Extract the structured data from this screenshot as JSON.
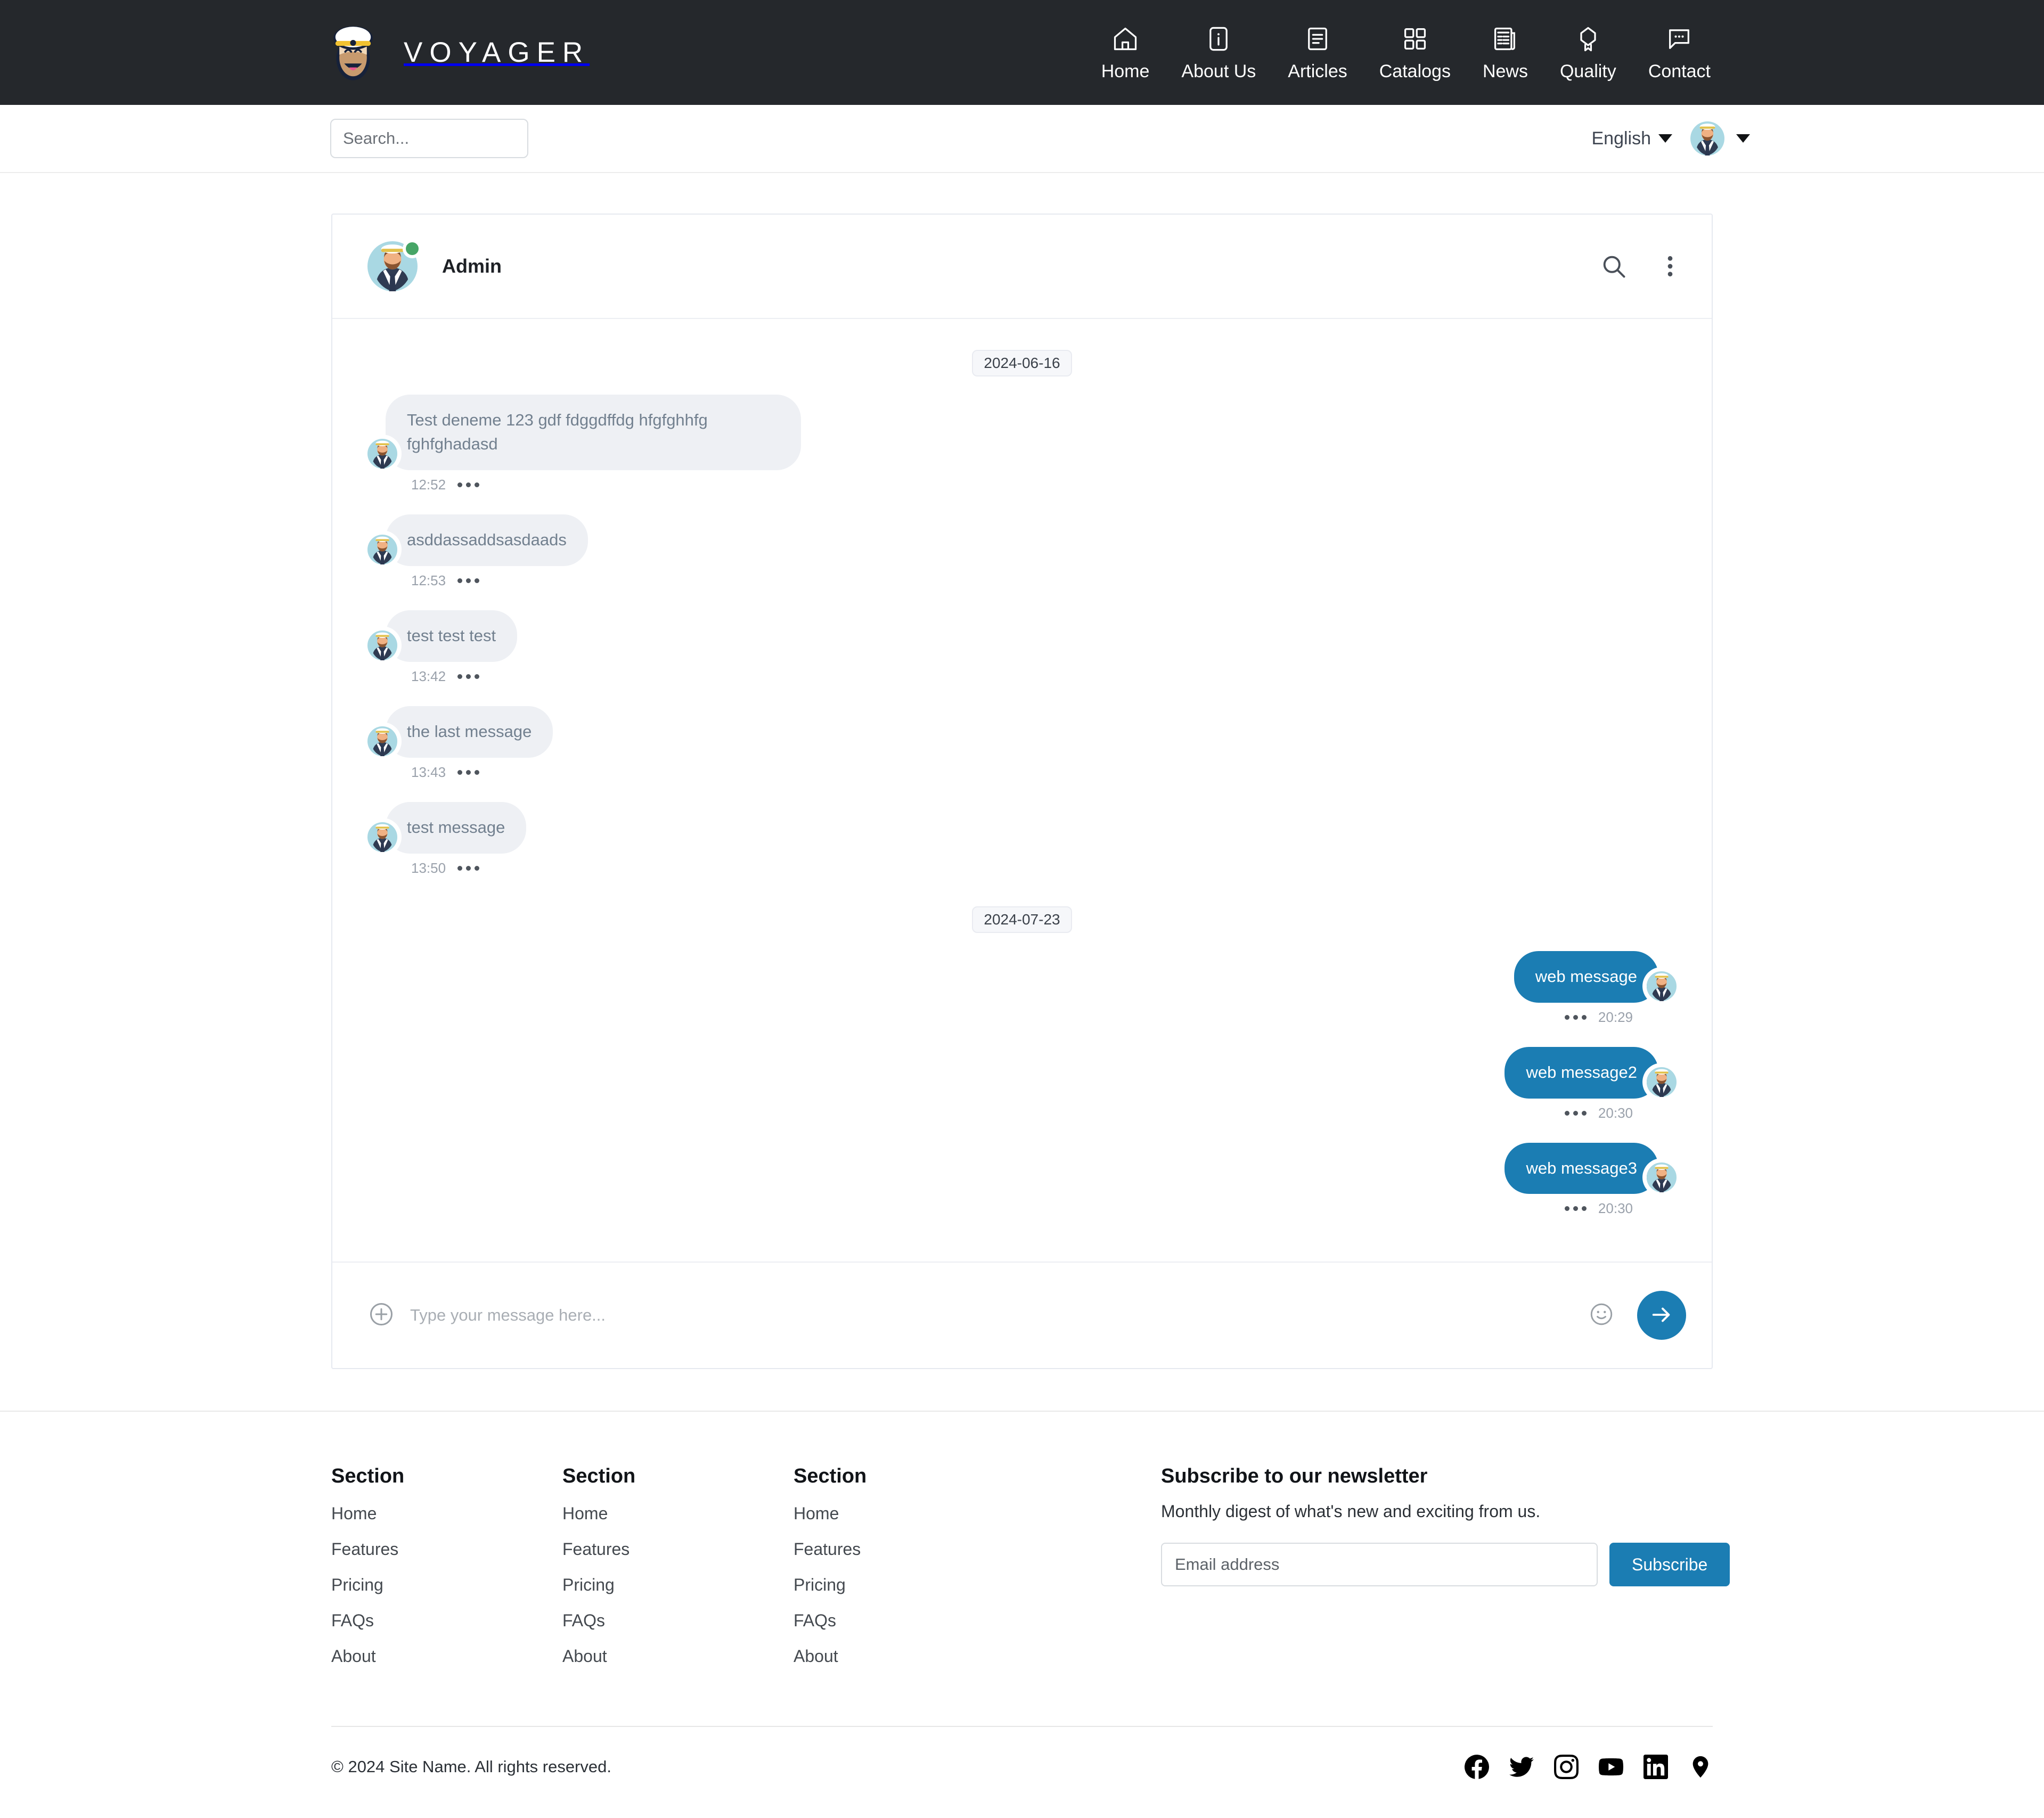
{
  "brand": {
    "name": "VOYAGER",
    "logo_icon": "sailor-captain-logo"
  },
  "nav": {
    "items": [
      {
        "label": "Home",
        "icon": "home-icon"
      },
      {
        "label": "About Us",
        "icon": "info-document-icon"
      },
      {
        "label": "Articles",
        "icon": "article-lines-icon"
      },
      {
        "label": "Catalogs",
        "icon": "grid-squares-icon"
      },
      {
        "label": "News",
        "icon": "newspaper-icon"
      },
      {
        "label": "Quality",
        "icon": "award-ribbon-icon"
      },
      {
        "label": "Contact",
        "icon": "chat-bubble-dots-icon"
      }
    ]
  },
  "utility": {
    "search_placeholder": "Search...",
    "search_value": "",
    "language": "English",
    "avatar_icon": "captain-avatar"
  },
  "chat": {
    "title": "Admin",
    "status": "online",
    "status_color": "#46a566",
    "search_icon": "search-icon",
    "menu_icon": "more-vertical-icon",
    "accent_color": "#1b7db3",
    "incoming_bubble_color": "#eef0f4",
    "groups": [
      {
        "date": "2024-06-16",
        "messages": [
          {
            "text": "Test deneme 123 gdf fdggdffdg hfgfghhfg fghfghadasd",
            "time": "12:52",
            "direction": "in"
          },
          {
            "text": "asddassaddsasdaads",
            "time": "12:53",
            "direction": "in"
          },
          {
            "text": "test test test",
            "time": "13:42",
            "direction": "in"
          },
          {
            "text": "the last message",
            "time": "13:43",
            "direction": "in"
          },
          {
            "text": "test message",
            "time": "13:50",
            "direction": "in"
          }
        ]
      },
      {
        "date": "2024-07-23",
        "messages": [
          {
            "text": "web message",
            "time": "20:29",
            "direction": "out"
          },
          {
            "text": "web message2",
            "time": "20:30",
            "direction": "out"
          },
          {
            "text": "web message3",
            "time": "20:30",
            "direction": "out"
          }
        ]
      }
    ],
    "composer": {
      "attach_icon": "plus-circle-icon",
      "placeholder": "Type your message here...",
      "value": "",
      "emoji_icon": "smiley-icon",
      "send_icon": "arrow-right-icon"
    }
  },
  "footer": {
    "columns": [
      {
        "title": "Section",
        "links": [
          "Home",
          "Features",
          "Pricing",
          "FAQs",
          "About"
        ]
      },
      {
        "title": "Section",
        "links": [
          "Home",
          "Features",
          "Pricing",
          "FAQs",
          "About"
        ]
      },
      {
        "title": "Section",
        "links": [
          "Home",
          "Features",
          "Pricing",
          "FAQs",
          "About"
        ]
      }
    ],
    "newsletter": {
      "title": "Subscribe to our newsletter",
      "subtitle": "Monthly digest of what's new and exciting from us.",
      "email_placeholder": "Email address",
      "email_value": "",
      "button_label": "Subscribe"
    },
    "copyright": "© 2024 Site Name. All rights reserved.",
    "socials": [
      {
        "name": "facebook-icon"
      },
      {
        "name": "twitter-icon"
      },
      {
        "name": "instagram-icon"
      },
      {
        "name": "youtube-icon"
      },
      {
        "name": "linkedin-icon"
      },
      {
        "name": "location-pin-icon"
      }
    ]
  }
}
